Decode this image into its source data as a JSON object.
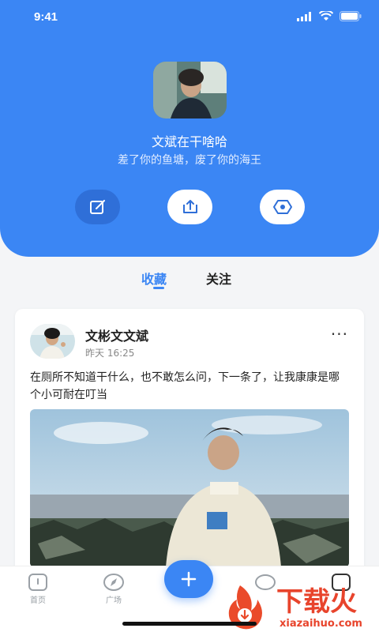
{
  "status_bar": {
    "time": "9:41"
  },
  "profile": {
    "name": "文斌在干啥哈",
    "bio": "差了你的鱼塘，废了你的海王"
  },
  "actions": [
    {
      "icon": "edit-icon"
    },
    {
      "icon": "share-icon"
    },
    {
      "icon": "eye-icon"
    }
  ],
  "tabs": {
    "favorites": "收藏",
    "following": "关注"
  },
  "post": {
    "author": "文彬文文斌",
    "time": "昨天 16:25",
    "text": "在厕所不知道干什么，也不敢怎么问，下一条了，让我康康是哪个小可耐在叮当",
    "more_icon": "···"
  },
  "tabbar": {
    "home": "首页",
    "plaza": "广场"
  },
  "watermark": {
    "text": "下载火",
    "sub": "xiazaihuo.com"
  },
  "colors": {
    "primary": "#3b86f4",
    "watermark": "#e8442c"
  }
}
